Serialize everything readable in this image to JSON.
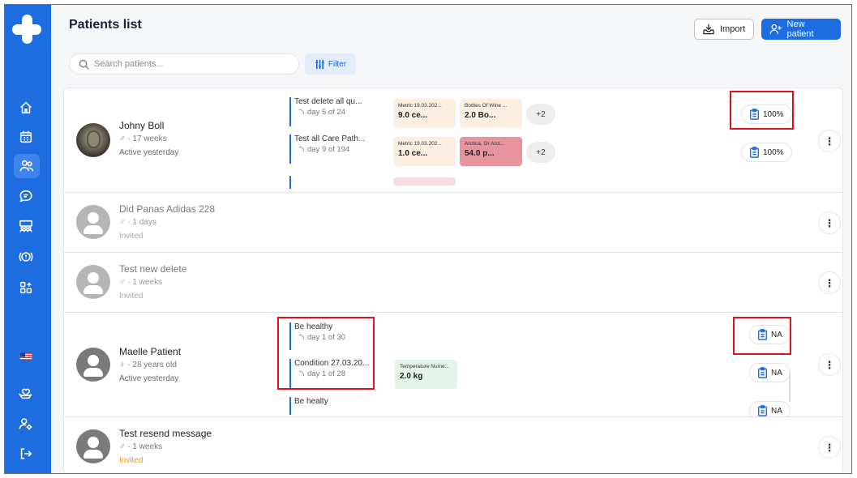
{
  "colors": {
    "brand": "#1d6de0",
    "highlight": "#e2101a",
    "invited_orange": "#f0961e"
  },
  "sidebar": {
    "logo": "app-logo",
    "items": [
      "home-icon",
      "calendar-icon",
      "patients-icon",
      "chat-icon",
      "groups-icon",
      "alert-icon",
      "apps-icon"
    ],
    "bottom": [
      "us-flag-icon",
      "care-hand-icon",
      "user-settings-icon",
      "logout-icon"
    ]
  },
  "header": {
    "title": "Patients list",
    "import_label": "Import",
    "new_patient_label": "New patient"
  },
  "search": {
    "placeholder": "Search patients..."
  },
  "filter_label": "Filter",
  "patients": [
    {
      "name": "Johny Boll",
      "gender": "♂",
      "age": "17 weeks",
      "status": "Active yesterday",
      "care_paths": [
        {
          "title": "Test delete all qu...",
          "day": "day 5 of 24"
        },
        {
          "title": "Test all Care Path...",
          "day": "day 9 of 194"
        }
      ],
      "metrics": [
        {
          "label": "Metric 19.03.202...",
          "value": "9.0 ce..."
        },
        {
          "label": "Bottles Of Wine ...",
          "value": "2.0 Bo..."
        },
        {
          "label": "Metric 19.03.202...",
          "value": "1.0 ce..."
        },
        {
          "label": "Arctica, Or Arct...",
          "value": "54.0 p..."
        }
      ],
      "more": [
        "+2",
        "+2"
      ],
      "adherence": [
        "100%",
        "100%"
      ]
    },
    {
      "name": "Did Panas Adidas 228",
      "gender": "♂",
      "age": "1 days",
      "status": "Invited"
    },
    {
      "name": "Test new delete",
      "gender": "♂",
      "age": "1 weeks",
      "status": "Invited"
    },
    {
      "name": "Maelle Patient",
      "gender": "♀",
      "age": "28 years old",
      "status": "Active yesterday",
      "care_paths": [
        {
          "title": "Be healthy",
          "day": "day 1 of 30"
        },
        {
          "title": "Condition 27.03.20...",
          "day": "day 1 of 28"
        },
        {
          "title": "Be healty",
          "day": ""
        }
      ],
      "metrics": [
        {
          "label": "Temperature Nume...",
          "value": "2.0 kg"
        }
      ],
      "adherence": [
        "NA",
        "NA",
        "NA"
      ]
    },
    {
      "name": "Test resend message",
      "gender": "♂",
      "age": "1 weeks",
      "status": "Invited"
    }
  ],
  "separator": "·",
  "kebab_label": "⋮"
}
